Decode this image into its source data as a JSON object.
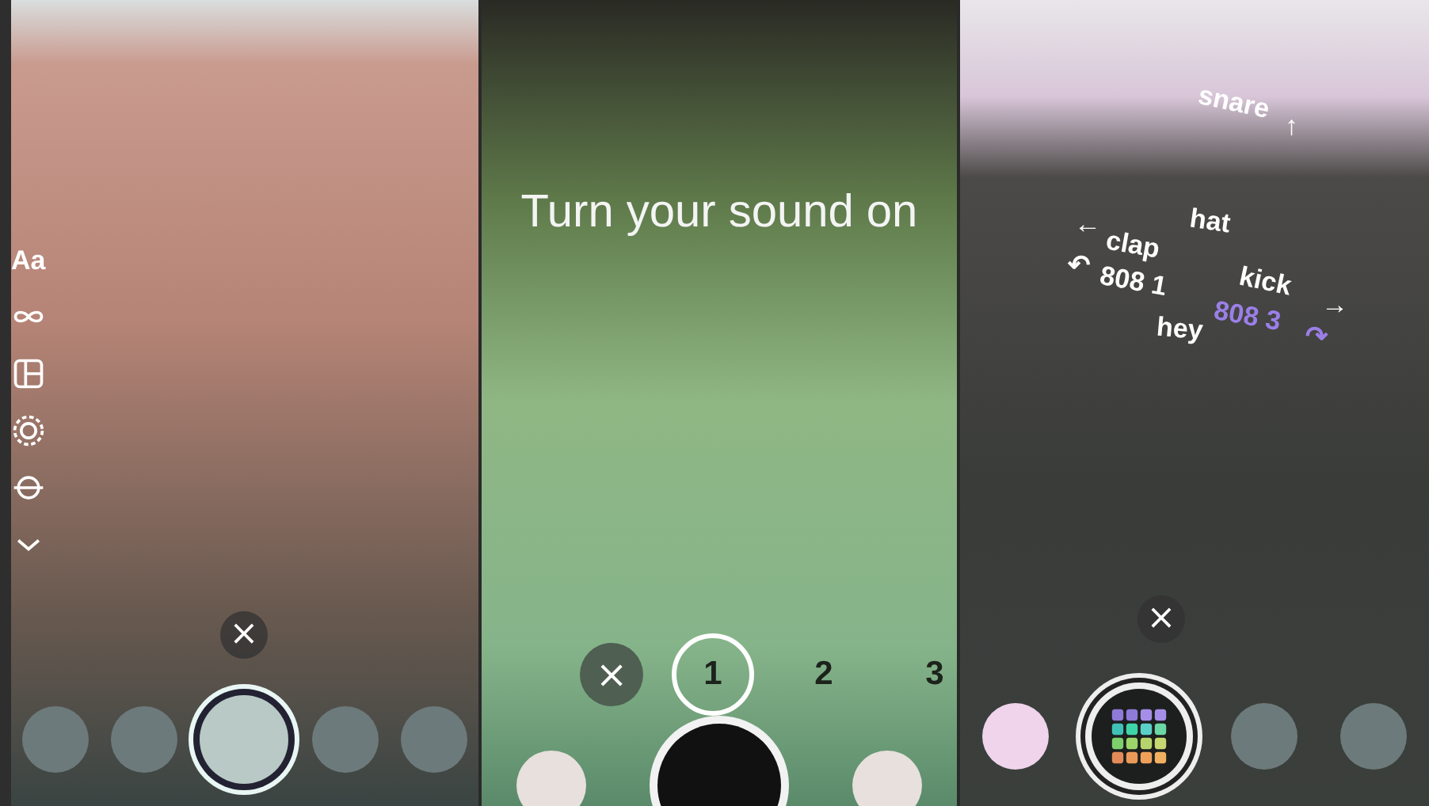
{
  "panels": [
    {
      "kind": "tools",
      "tools": [
        {
          "kind": "text",
          "label": "Aa"
        },
        {
          "kind": "loop"
        },
        {
          "kind": "layout"
        },
        {
          "kind": "focus"
        },
        {
          "kind": "level"
        },
        {
          "kind": "more"
        }
      ],
      "close": "×",
      "carousel": [
        {
          "selected": false
        },
        {
          "selected": false
        },
        {
          "selected": true
        },
        {
          "selected": false
        },
        {
          "selected": false
        }
      ]
    },
    {
      "kind": "countdown",
      "message": "Turn your sound on",
      "close": "×",
      "counts": [
        {
          "label": "1",
          "selected": true
        },
        {
          "label": "2",
          "selected": false
        },
        {
          "label": "3",
          "selected": false
        }
      ],
      "carousel": [
        {
          "selected": false
        },
        {
          "selected": true
        },
        {
          "selected": false
        }
      ]
    },
    {
      "kind": "beats",
      "labels": [
        {
          "text": "snare",
          "color": "#ffffff"
        },
        {
          "text": "↑",
          "color": "#ffffff"
        },
        {
          "text": "hat",
          "color": "#ffffff"
        },
        {
          "text": "←",
          "color": "#ffffff"
        },
        {
          "text": "clap",
          "color": "#ffffff"
        },
        {
          "text": "↶",
          "color": "#ffffff"
        },
        {
          "text": "808 1",
          "color": "#ffffff"
        },
        {
          "text": "kick",
          "color": "#ffffff"
        },
        {
          "text": "→",
          "color": "#ffffff"
        },
        {
          "text": "808 3",
          "color": "#9b7fe8"
        },
        {
          "text": "↷",
          "color": "#9b7fe8"
        },
        {
          "text": "hey",
          "color": "#ffffff"
        }
      ],
      "close": "×",
      "carousel": [
        {
          "selected": false
        },
        {
          "selected": true
        },
        {
          "selected": false
        },
        {
          "selected": false
        }
      ]
    }
  ]
}
